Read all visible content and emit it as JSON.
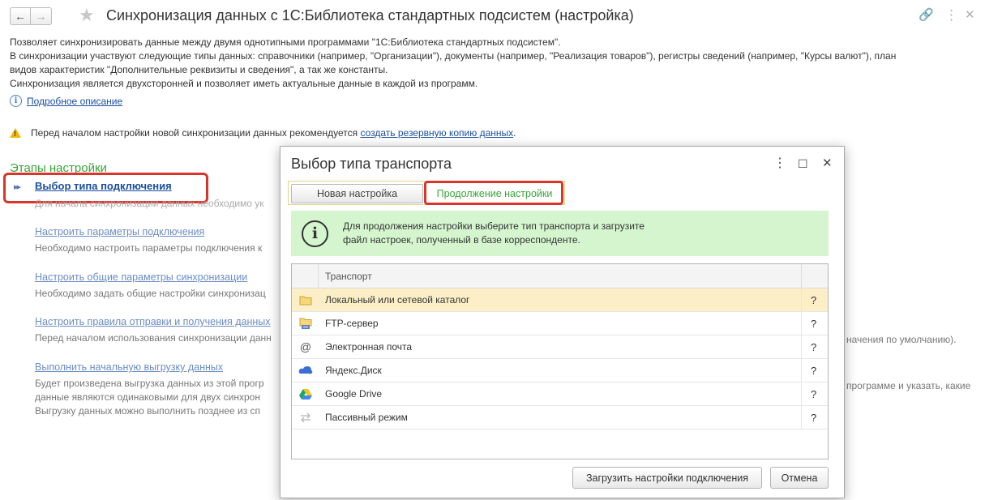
{
  "window": {
    "title": "Синхронизация данных с 1С:Библиотека стандартных подсистем (настройка)",
    "back_glyph": "←",
    "forward_glyph": "→",
    "star_glyph": "★",
    "link_glyph": "🔗",
    "more_glyph": "⋮",
    "close_glyph": "✕"
  },
  "description": {
    "lines": [
      "Позволяет синхронизировать данные между двумя однотипными программами \"1С:Библиотека стандартных подсистем\".",
      "В синхронизации участвуют следующие типы данных: справочники (например, \"Организации\"), документы (например, \"Реализация товаров\"), регистры сведений (например, \"Курсы валют\"), план",
      "видов характеристик \"Дополнительные реквизиты и сведения\", а так же константы.",
      "Синхронизация является двухсторонней и позволяет иметь актуальные данные в каждой из программ."
    ],
    "details_link": "Подробное описание",
    "info_glyph": "i"
  },
  "warning": {
    "text": "Перед началом настройки новой синхронизации данных рекомендуется ",
    "link": "создать резервную копию данных",
    "tail": ".",
    "glyph": "!"
  },
  "stages": {
    "title": "Этапы настройки",
    "arrow_glyph": "▸▸",
    "active": {
      "label": "Выбор типа подключения",
      "note": "Для начала синхронизации данных необходимо ук"
    },
    "items": [
      {
        "label": "Настроить параметры подключения",
        "note": "Необходимо настроить параметры подключения к"
      },
      {
        "label": "Настроить общие параметры синхронизации",
        "note": "Необходимо задать общие настройки синхронизац"
      },
      {
        "label": "Настроить правила отправки и получения данных",
        "note": "Перед началом использования синхронизации данн"
      },
      {
        "label": "Выполнить начальную выгрузку данных",
        "note": "Будет произведена выгрузка данных из этой прогр",
        "note2": "данные являются одинаковыми для двух синхрон",
        "note3": "Выгрузку данных можно выполнить позднее из сп"
      }
    ],
    "right_tails": {
      "rules": "начения по умолчанию).",
      "upload": "программе и указать, какие"
    }
  },
  "dialog": {
    "title": "Выбор типа транспорта",
    "more_glyph": "⋮",
    "max_glyph": "☐",
    "close_glyph": "✕",
    "tabs": {
      "new": "Новая настройка",
      "continue": "Продолжение настройки"
    },
    "banner": {
      "glyph": "i",
      "line1": "Для продолжения настройки выберите тип транспорта и загрузите",
      "line2": "файл настроек, полученный в базе корреспонденте."
    },
    "table": {
      "header": "Транспорт",
      "rows": [
        {
          "icon": "folder-icon",
          "name": "Локальный или сетевой каталог",
          "help": "?"
        },
        {
          "icon": "ftp-server-icon",
          "name": "FTP-сервер",
          "help": "?"
        },
        {
          "icon": "email-at-icon",
          "name": "Электронная почта",
          "help": "?"
        },
        {
          "icon": "yandex-disk-icon",
          "name": "Яндекс.Диск",
          "help": "?"
        },
        {
          "icon": "google-drive-icon",
          "name": "Google Drive",
          "help": "?"
        },
        {
          "icon": "passive-mode-icon",
          "name": "Пассивный режим",
          "help": "?"
        }
      ]
    },
    "buttons": {
      "load": "Загрузить настройки подключения",
      "cancel": "Отмена"
    }
  }
}
